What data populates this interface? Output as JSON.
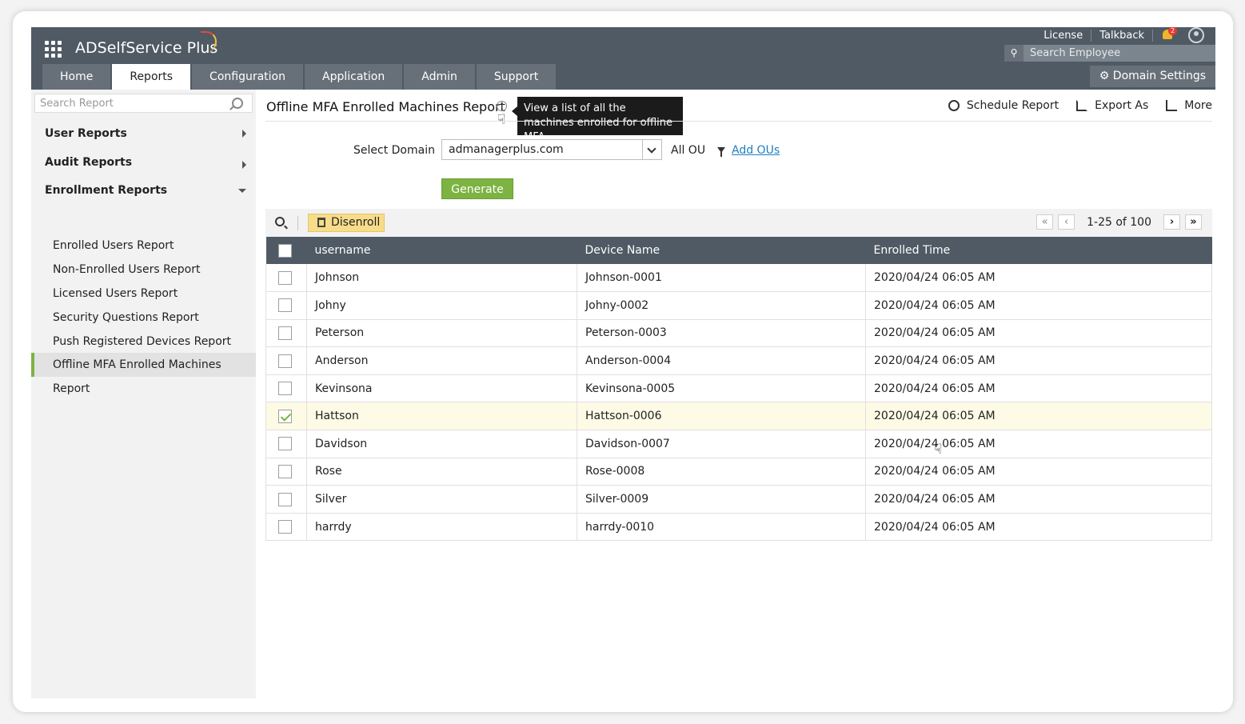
{
  "app": {
    "brand": "ADSelfService Plus",
    "top_links": [
      "License",
      "Talkback"
    ],
    "notification_count": "2",
    "search_employee_placeholder": "Search Employee",
    "tabs": [
      "Home",
      "Reports",
      "Configuration",
      "Application",
      "Admin",
      "Support"
    ],
    "active_tab": "Reports",
    "domain_settings": "Domain Settings"
  },
  "sidebar": {
    "search_placeholder": "Search Report",
    "groups": [
      "User Reports",
      "Audit Reports",
      "Enrollment Reports"
    ],
    "items": [
      "Enrolled Users Report",
      "Non-Enrolled Users Report",
      "Licensed Users Report",
      "Security Questions Report",
      "Push Registered Devices Report",
      "Offline MFA Enrolled Machines Report"
    ],
    "active_item": "Offline MFA Enrolled Machines Report"
  },
  "main": {
    "title": "Offline MFA Enrolled Machines Report",
    "tooltip": "View a list of all the machines enrolled for offline MFA",
    "actions": [
      "Schedule Report",
      "Export As",
      "More"
    ],
    "select_domain_label": "Select Domain",
    "domain_value": "admanagerplus.com",
    "all_ou": "All OU",
    "add_ous": "Add OUs",
    "generate": "Generate",
    "disenroll": "Disenroll",
    "pager": "1-25 of 100",
    "columns": [
      "username",
      "Device Name",
      "Enrolled Time"
    ],
    "rows": [
      {
        "username": "Johnson",
        "device": "Johnson-0001",
        "time": "2020/04/24 06:05 AM",
        "checked": false
      },
      {
        "username": "Johny",
        "device": "Johny-0002",
        "time": "2020/04/24 06:05 AM",
        "checked": false
      },
      {
        "username": "Peterson",
        "device": "Peterson-0003",
        "time": "2020/04/24 06:05 AM",
        "checked": false
      },
      {
        "username": "Anderson",
        "device": "Anderson-0004",
        "time": "2020/04/24 06:05 AM",
        "checked": false
      },
      {
        "username": "Kevinsona",
        "device": "Kevinsona-0005",
        "time": "2020/04/24 06:05 AM",
        "checked": false
      },
      {
        "username": "Hattson",
        "device": "Hattson-0006",
        "time": "2020/04/24 06:05 AM",
        "checked": true
      },
      {
        "username": "Davidson",
        "device": "Davidson-0007",
        "time": "2020/04/24 06:05 AM",
        "checked": false
      },
      {
        "username": "Rose",
        "device": "Rose-0008",
        "time": "2020/04/24 06:05 AM",
        "checked": false
      },
      {
        "username": "Silver",
        "device": "Silver-0009",
        "time": "2020/04/24 06:05 AM",
        "checked": false
      },
      {
        "username": "harrdy",
        "device": "harrdy-0010",
        "time": "2020/04/24 06:05 AM",
        "checked": false
      }
    ]
  }
}
